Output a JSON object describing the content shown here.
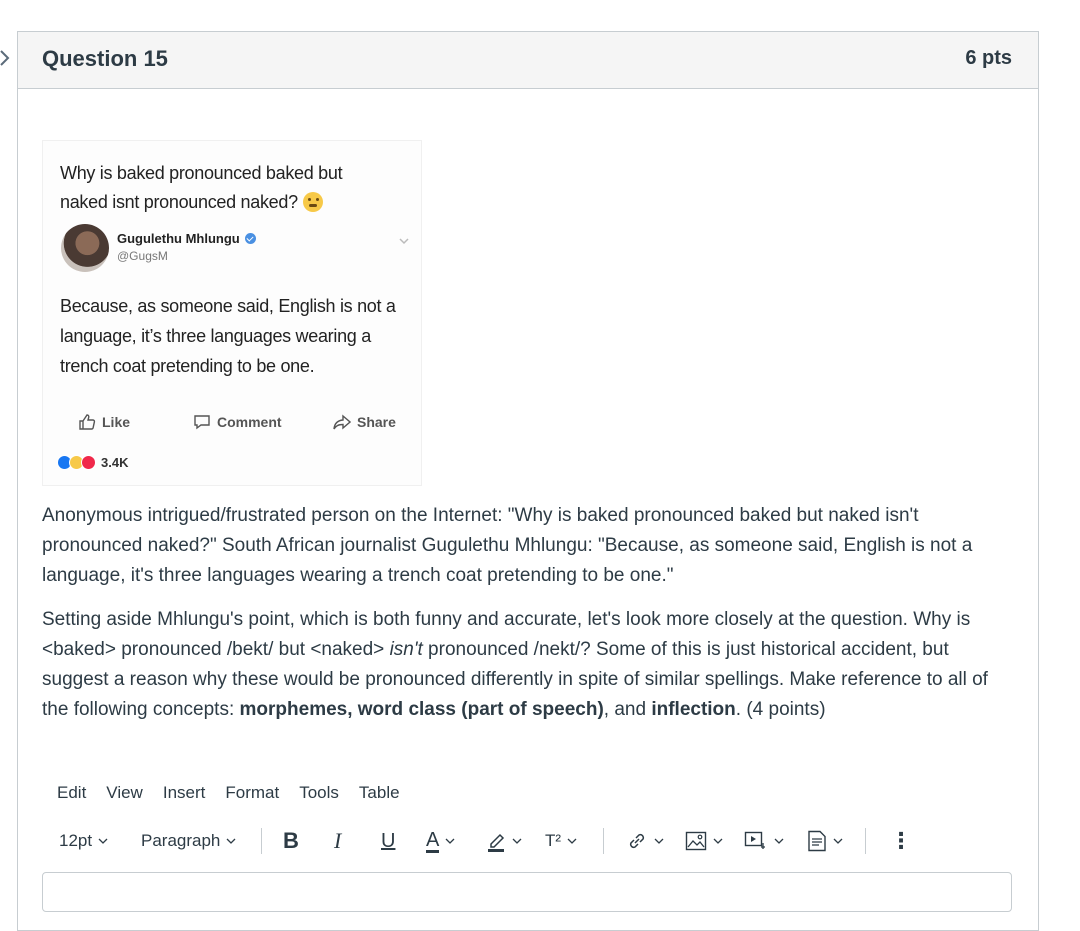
{
  "question": {
    "title": "Question 15",
    "points": "6 pts"
  },
  "post_image": {
    "question_text": "Why is baked pronounced baked but naked isnt pronounced naked?",
    "author_name": "Gugulethu Mhlungu",
    "author_handle": "@GugsM",
    "answer_text": "Because, as someone said, English is not a language, it’s three languages wearing a trench coat pretending to be one.",
    "actions": [
      "Like",
      "Comment",
      "Share"
    ],
    "reaction_count": "3.4K"
  },
  "body": {
    "paragraph1": "Anonymous intrigued/frustrated person on the Internet: \"Why is baked pronounced baked but naked isn't pronounced naked?\" South African journalist Gugulethu Mhlungu: \"Because, as someone said, English is not a language, it's three languages wearing a trench coat pretending to be one.\"",
    "p2_a": "Setting aside Mhlungu's point, which is both funny and accurate, let's look more closely at the question. Why is <baked> pronounced /bekt/ but <naked> ",
    "p2_isnt": "isn't",
    "p2_b": " pronounced /nekt/? Some of this is just historical accident, but suggest a reason why these would be pronounced differently in spite of similar spellings. Make reference to all of the following concepts: ",
    "p2_c1": "morphemes, word class (part of speech)",
    "p2_d": ", and ",
    "p2_c2": "inflection",
    "p2_e": ". (4 points)"
  },
  "editor": {
    "menu": [
      "Edit",
      "View",
      "Insert",
      "Format",
      "Tools",
      "Table"
    ],
    "font_size": "12pt",
    "block_format": "Paragraph",
    "bold_label": "B",
    "italic_label": "I",
    "underline_label": "U",
    "font_color_label": "A",
    "superscript_label": "T²",
    "more_label": "⋮"
  }
}
